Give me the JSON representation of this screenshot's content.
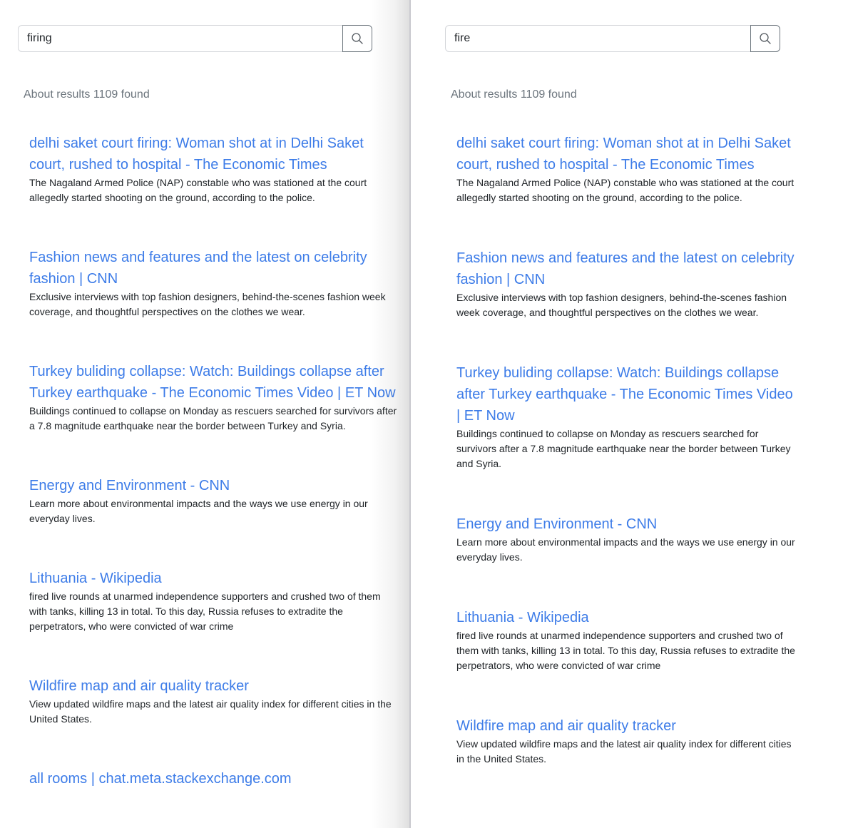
{
  "left": {
    "query": "firing",
    "results_count": "About results 1109 found",
    "results": [
      {
        "title": "delhi saket court firing: Woman shot at in Delhi Saket court, rushed to hospital - The Economic Times",
        "desc": "The Nagaland Armed Police (NAP) constable who was stationed at the court allegedly started shooting on the ground, according to the police."
      },
      {
        "title": "Fashion news and features and the latest on celebrity fashion | CNN",
        "desc": "Exclusive interviews with top fashion designers, behind-the-scenes fashion week coverage, and thoughtful perspectives on the clothes we wear."
      },
      {
        "title": "Turkey buliding collapse: Watch: Buildings collapse after Turkey earthquake - The Economic Times Video | ET Now",
        "desc": "Buildings continued to collapse on Monday as rescuers searched for survivors after a 7.8 magnitude earthquake near the border between Turkey and Syria."
      },
      {
        "title": "Energy and Environment - CNN",
        "desc": "Learn more about environmental impacts and the ways we use energy in our everyday lives."
      },
      {
        "title": "Lithuania - Wikipedia",
        "desc": "fired live rounds at unarmed independence supporters and crushed two of them with tanks, killing 13 in total. To this day, Russia refuses to extradite the perpetrators, who were convicted of war crime"
      },
      {
        "title": "Wildfire map and air quality tracker",
        "desc": "View updated wildfire maps and the latest air quality index for different cities in the United States."
      },
      {
        "title": "all rooms | chat.meta.stackexchange.com",
        "desc": ""
      }
    ]
  },
  "right": {
    "query": "fire",
    "results_count": "About results 1109 found",
    "results": [
      {
        "title": "delhi saket court firing: Woman shot at in Delhi Saket court, rushed to hospital - The Economic Times",
        "desc": "The Nagaland Armed Police (NAP) constable who was stationed at the court allegedly started shooting on the ground, according to the police."
      },
      {
        "title": "Fashion news and features and the latest on celebrity fashion | CNN",
        "desc": "Exclusive interviews with top fashion designers, behind-the-scenes fashion week coverage, and thoughtful perspectives on the clothes we wear."
      },
      {
        "title": "Turkey buliding collapse: Watch: Buildings collapse after Turkey earthquake - The Economic Times Video | ET Now",
        "desc": "Buildings continued to collapse on Monday as rescuers searched for survivors after a 7.8 magnitude earthquake near the border between Turkey and Syria."
      },
      {
        "title": "Energy and Environment - CNN",
        "desc": "Learn more about environmental impacts and the ways we use energy in our everyday lives."
      },
      {
        "title": "Lithuania - Wikipedia",
        "desc": "fired live rounds at unarmed independence supporters and crushed two of them with tanks, killing 13 in total. To this day, Russia refuses to extradite the perpetrators, who were convicted of war crime"
      },
      {
        "title": "Wildfire map and air quality tracker",
        "desc": "View updated wildfire maps and the latest air quality index for different cities in the United States."
      }
    ]
  },
  "icons": {
    "search_button": "search-icon"
  },
  "colors": {
    "link": "#3d7ce8",
    "muted_text": "#6c757d",
    "body_text": "#212529",
    "button_border": "#6c757d"
  }
}
